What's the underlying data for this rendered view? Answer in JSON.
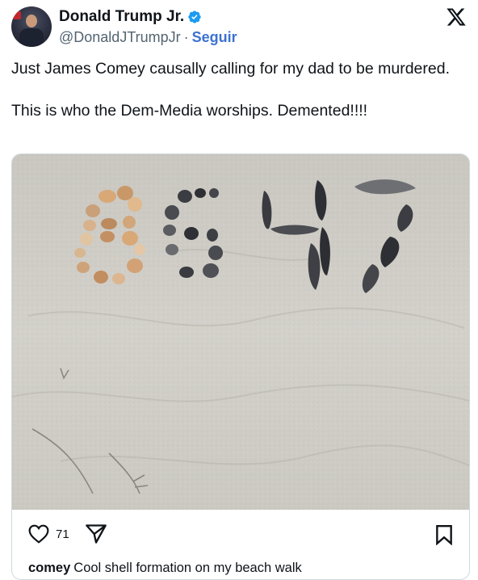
{
  "author": {
    "name": "Donald Trump Jr.",
    "handle": "@DonaldJTrumpJr",
    "separator": "·",
    "follow_label": "Seguir",
    "verified_icon": "verified-badge-icon"
  },
  "post": {
    "paragraphs": [
      "Just James Comey causally calling for my dad to be murdered.",
      "This is who the Dem-Media worships. Demented!!!!"
    ]
  },
  "embed": {
    "image_icon": "beach-sand-shells-photo",
    "likes": "71",
    "caption_user": "comey",
    "caption_text": "Cool shell formation on my beach walk"
  },
  "colors": {
    "follow": "#3c72d1",
    "verified": "#1d9bf0",
    "sand": "#cfcdc6",
    "text": "#0f1419",
    "muted": "#536471"
  }
}
